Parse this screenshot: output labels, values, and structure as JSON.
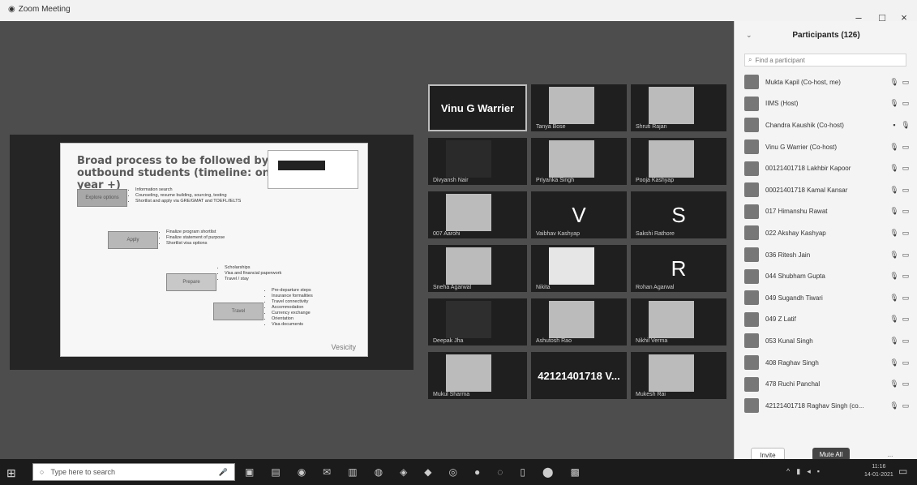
{
  "window": {
    "app_title": "Zoom Meeting",
    "app_icon": "zoom-icon",
    "minimize": "–",
    "maximize": "□",
    "close": "×"
  },
  "share": {
    "title": "Broad process to be followed by outbound students (timeline: one year +)",
    "boxes": [
      {
        "label": "Explore options"
      },
      {
        "label": "Apply"
      },
      {
        "label": "Prepare"
      },
      {
        "label": "Travel"
      }
    ],
    "lists": [
      [
        "Information search",
        "Counseling, resume building, sourcing, testing",
        "Shortlist and apply via GRE/GMAT and TOEFL/IELTS"
      ],
      [
        "Finalize program shortlist",
        "Finalize statement of purpose",
        "Shortlist visa options"
      ],
      [
        "Scholarships",
        "Visa and financial paperwork",
        "Travel / stay"
      ],
      [
        "Pre-departure steps",
        "Insurance formalities",
        "Travel connectivity",
        "Accommodation",
        "Currency exchange",
        "Orientation",
        "Visa documents"
      ]
    ],
    "logo": "Vesicity"
  },
  "tiles": [
    {
      "name": "",
      "big_text": "Vinu G Warrier",
      "type": "active"
    },
    {
      "name": "Tanya Bose",
      "type": "photo"
    },
    {
      "name": "Shruti Rajan",
      "type": "photo"
    },
    {
      "name": "Divyansh Nair",
      "type": "photo"
    },
    {
      "name": "Priyanka Singh",
      "type": "photo"
    },
    {
      "name": "Pooja Kashyap",
      "type": "photo"
    },
    {
      "name": "007 Aarohi",
      "type": "photo"
    },
    {
      "name": "Vaibhav Kashyap",
      "letter": "V",
      "type": "letter"
    },
    {
      "name": "Sakshi Rathore",
      "letter": "S",
      "type": "letter"
    },
    {
      "name": "Sneha Agarwal",
      "type": "photo"
    },
    {
      "name": "Nikita",
      "type": "photo"
    },
    {
      "name": "Rohan Agarwal",
      "letter": "R",
      "type": "letter"
    },
    {
      "name": "Deepak Jha",
      "type": "photo"
    },
    {
      "name": "Ashutosh Rao",
      "type": "photo"
    },
    {
      "name": "Nikhil Verma",
      "type": "photo"
    },
    {
      "name": "Mukul Sharma",
      "type": "photo"
    },
    {
      "name": "",
      "big_text": "42121401718 V...",
      "type": "text"
    },
    {
      "name": "Mukesh Rai",
      "type": "photo"
    }
  ],
  "participants_panel": {
    "header": "Participants (126)",
    "collapse_icon": "chevron-down-icon",
    "search_placeholder": "Find a participant",
    "search_icon": "search-icon",
    "participants": [
      {
        "name": "Mukta Kapil (Co-host, me)",
        "mic": "🎙",
        "video": "▭"
      },
      {
        "name": "IIMS (Host)",
        "mic": "🎙",
        "video": "▭"
      },
      {
        "name": "Chandra Kaushik (Co-host)",
        "mic": "▪",
        "video": "🎙"
      },
      {
        "name": "Vinu G Warrier (Co-host)",
        "mic": "🎙",
        "video": "▭"
      },
      {
        "name": "00121401718 Lakhbir Kapoor",
        "mic": "🎙",
        "video": "▭"
      },
      {
        "name": "00021401718 Kamal Kansar",
        "mic": "🎙",
        "video": "▭"
      },
      {
        "name": "017 Himanshu Rawat",
        "mic": "🎙",
        "video": "▭"
      },
      {
        "name": "022 Akshay Kashyap",
        "mic": "🎙",
        "video": "▭"
      },
      {
        "name": "036 Ritesh Jain",
        "mic": "🎙",
        "video": "▭"
      },
      {
        "name": "044 Shubham Gupta",
        "mic": "🎙",
        "video": "▭"
      },
      {
        "name": "049 Sugandh Tiwari",
        "mic": "🎙",
        "video": "▭"
      },
      {
        "name": "049 Z Latif",
        "mic": "🎙",
        "video": "▭"
      },
      {
        "name": "053 Kunal Singh",
        "mic": "🎙",
        "video": "▭"
      },
      {
        "name": "408 Raghav Singh",
        "mic": "🎙",
        "video": "▭"
      },
      {
        "name": "478 Ruchi Panchal",
        "mic": "🎙",
        "video": "▭"
      },
      {
        "name": "42121401718 Raghav Singh (co...",
        "mic": "🎙",
        "video": "▭"
      }
    ],
    "invite_label": "Invite",
    "mute_all_label": "Mute All",
    "more_label": "..."
  },
  "taskbar": {
    "search_placeholder": "Type here to search",
    "start_icon": "windows-logo-icon",
    "time": "11:16",
    "date": "14-01-2021"
  }
}
